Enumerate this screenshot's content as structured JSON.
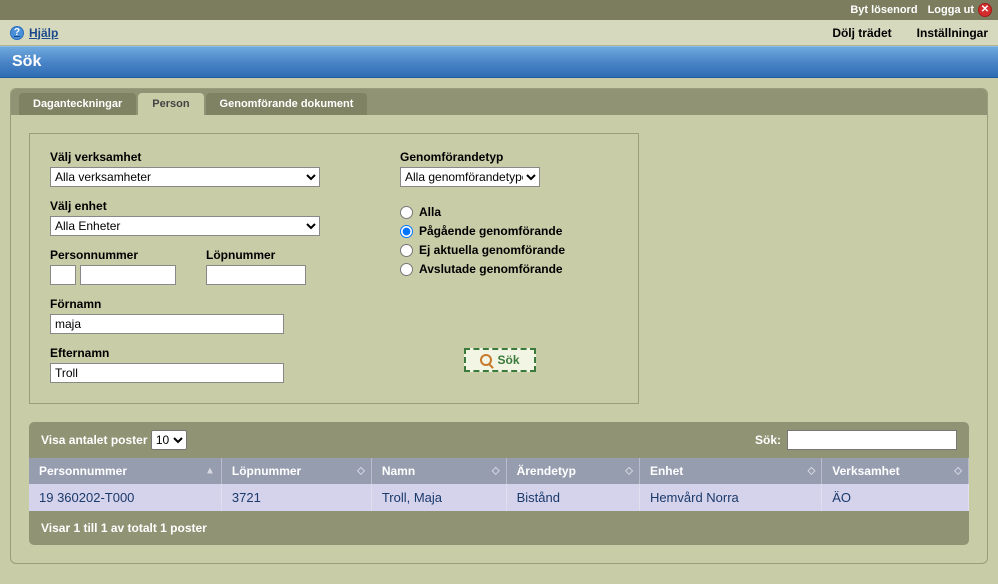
{
  "topbar": {
    "change_password": "Byt lösenord",
    "logout": "Logga ut"
  },
  "secondbar": {
    "help": "Hjälp",
    "hide_tree": "Dölj trädet",
    "settings": "Inställningar"
  },
  "titlebar": {
    "title": "Sök"
  },
  "tabs": {
    "daganteckningar": "Daganteckningar",
    "person": "Person",
    "genomforande": "Genomförande dokument"
  },
  "form": {
    "verksamhet_label": "Välj verksamhet",
    "verksamhet_value": "Alla verksamheter",
    "enhet_label": "Välj enhet",
    "enhet_value": "Alla Enheter",
    "personnummer_label": "Personnummer",
    "lopnummer_label": "Löpnummer",
    "personnummer_prefix": "",
    "personnummer_value": "",
    "lopnummer_value": "",
    "fornamn_label": "Förnamn",
    "fornamn_value": "maja",
    "efternamn_label": "Efternamn",
    "efternamn_value": "Troll",
    "genomforandetyp_label": "Genomförandetyp",
    "genomforandetyp_value": "Alla genomförandetyper",
    "radios": {
      "alla": "Alla",
      "pagaende": "Pågående genomförande",
      "ej_aktuella": "Ej aktuella genomförande",
      "avslutade": "Avslutade genomförande"
    },
    "search_button": "Sök"
  },
  "datatable": {
    "show_entries_label": "Visa antalet poster",
    "show_entries_value": "10",
    "search_label": "Sök:",
    "search_value": "",
    "headers": {
      "personnummer": "Personnummer",
      "lopnummer": "Löpnummer",
      "namn": "Namn",
      "arendetyp": "Ärendetyp",
      "enhet": "Enhet",
      "verksamhet": "Verksamhet"
    },
    "rows": [
      {
        "personnummer": "19 360202-T000",
        "lopnummer": "3721",
        "namn": "Troll, Maja",
        "arendetyp": "Bistånd",
        "enhet": "Hemvård Norra",
        "verksamhet": "ÄO"
      }
    ],
    "footer": "Visar 1 till 1 av totalt 1 poster"
  }
}
